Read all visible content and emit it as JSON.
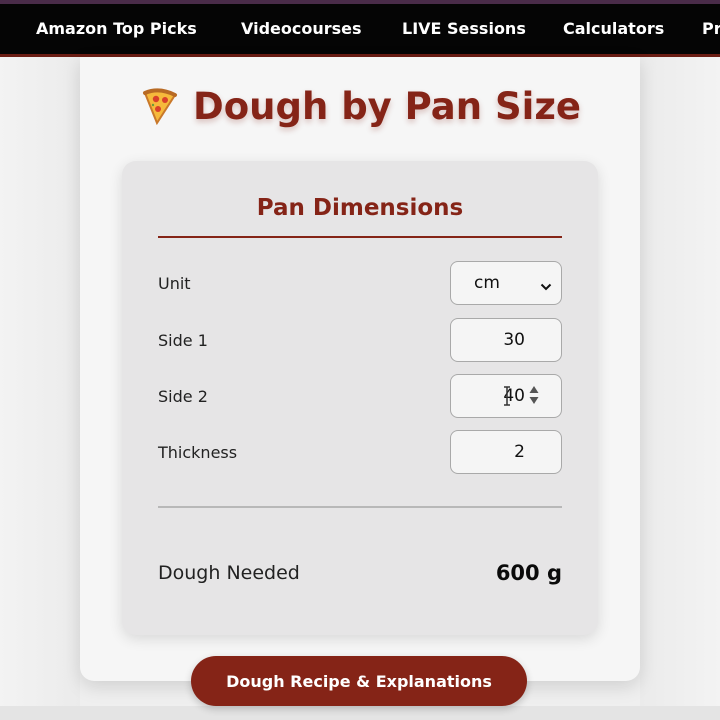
{
  "nav": {
    "items": [
      {
        "label": "Amazon Top Picks"
      },
      {
        "label": "Videocourses"
      },
      {
        "label": "LIVE Sessions"
      },
      {
        "label": "Calculators"
      },
      {
        "label": "Pr"
      }
    ]
  },
  "calculator": {
    "title": "Dough by Pan Size",
    "title_icon": "pizza-icon",
    "panel": {
      "heading": "Pan Dimensions",
      "unit": {
        "label": "Unit",
        "value": "cm"
      },
      "side1": {
        "label": "Side 1",
        "value": "30"
      },
      "side2": {
        "label": "Side 2",
        "value": "40"
      },
      "thickness": {
        "label": "Thickness",
        "value": "2"
      }
    },
    "result": {
      "label": "Dough Needed",
      "value": "600 g"
    }
  },
  "recipe_button": {
    "label": "Dough Recipe & Explanations"
  },
  "colors": {
    "brand": "#852417",
    "nav_bg": "#050505",
    "panel_bg": "#e6e5e6",
    "card_bg": "#f6f6f6"
  }
}
